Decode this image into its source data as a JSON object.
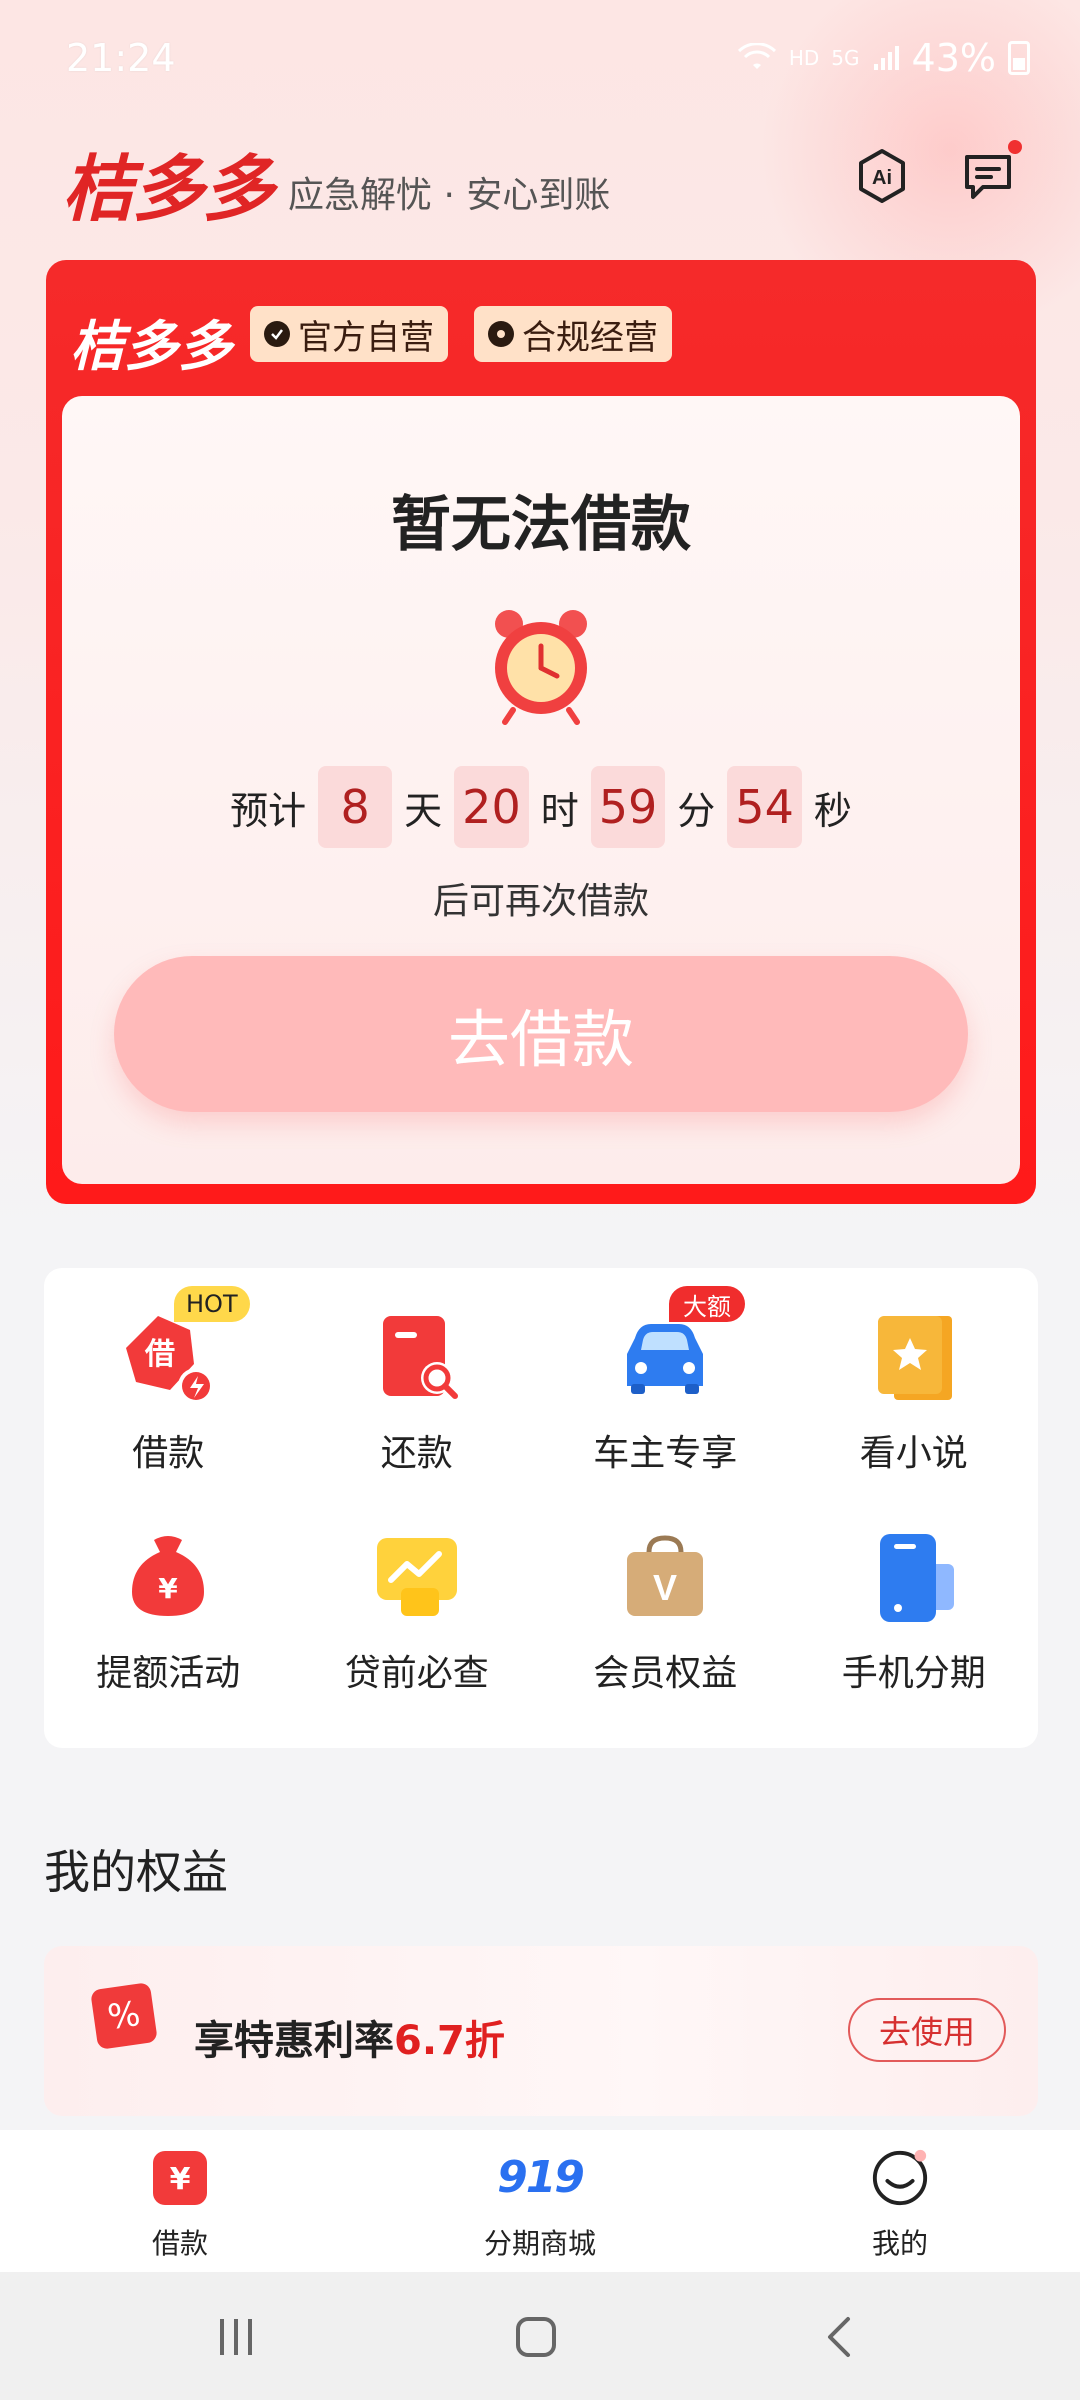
{
  "status_bar": {
    "time": "21:24",
    "network": "HD",
    "signal": "5G",
    "battery": "43%"
  },
  "header": {
    "brand": "桔多多",
    "slogan": "应急解忧 · 安心到账"
  },
  "loan_card": {
    "brand": "桔多多",
    "tags": [
      "官方自营",
      "合规经营"
    ],
    "title": "暂无法借款",
    "countdown": {
      "prefix": "预计",
      "days": "8",
      "days_unit": "天",
      "hours": "20",
      "hours_unit": "时",
      "minutes": "59",
      "minutes_unit": "分",
      "seconds": "54",
      "seconds_unit": "秒"
    },
    "subtitle": "后可再次借款",
    "button_label": "去借款"
  },
  "services": [
    {
      "label": "借款",
      "badge": "HOT"
    },
    {
      "label": "还款"
    },
    {
      "label": "车主专享",
      "badge": "大额"
    },
    {
      "label": "看小说"
    },
    {
      "label": "提额活动"
    },
    {
      "label": "贷前必查"
    },
    {
      "label": "会员权益"
    },
    {
      "label": "手机分期"
    }
  ],
  "benefits": {
    "title": "我的权益",
    "item": {
      "text": "享特惠利率",
      "highlight": "6.7折",
      "button": "去使用"
    }
  },
  "bottom_nav": [
    {
      "label": "借款"
    },
    {
      "label": "分期商城",
      "logo": "919"
    },
    {
      "label": "我的"
    }
  ],
  "colors": {
    "brand_red": "#e02525",
    "card_red": "#f52a2a",
    "button_pink": "#ffbaba",
    "accent_blue": "#2a70f0"
  }
}
